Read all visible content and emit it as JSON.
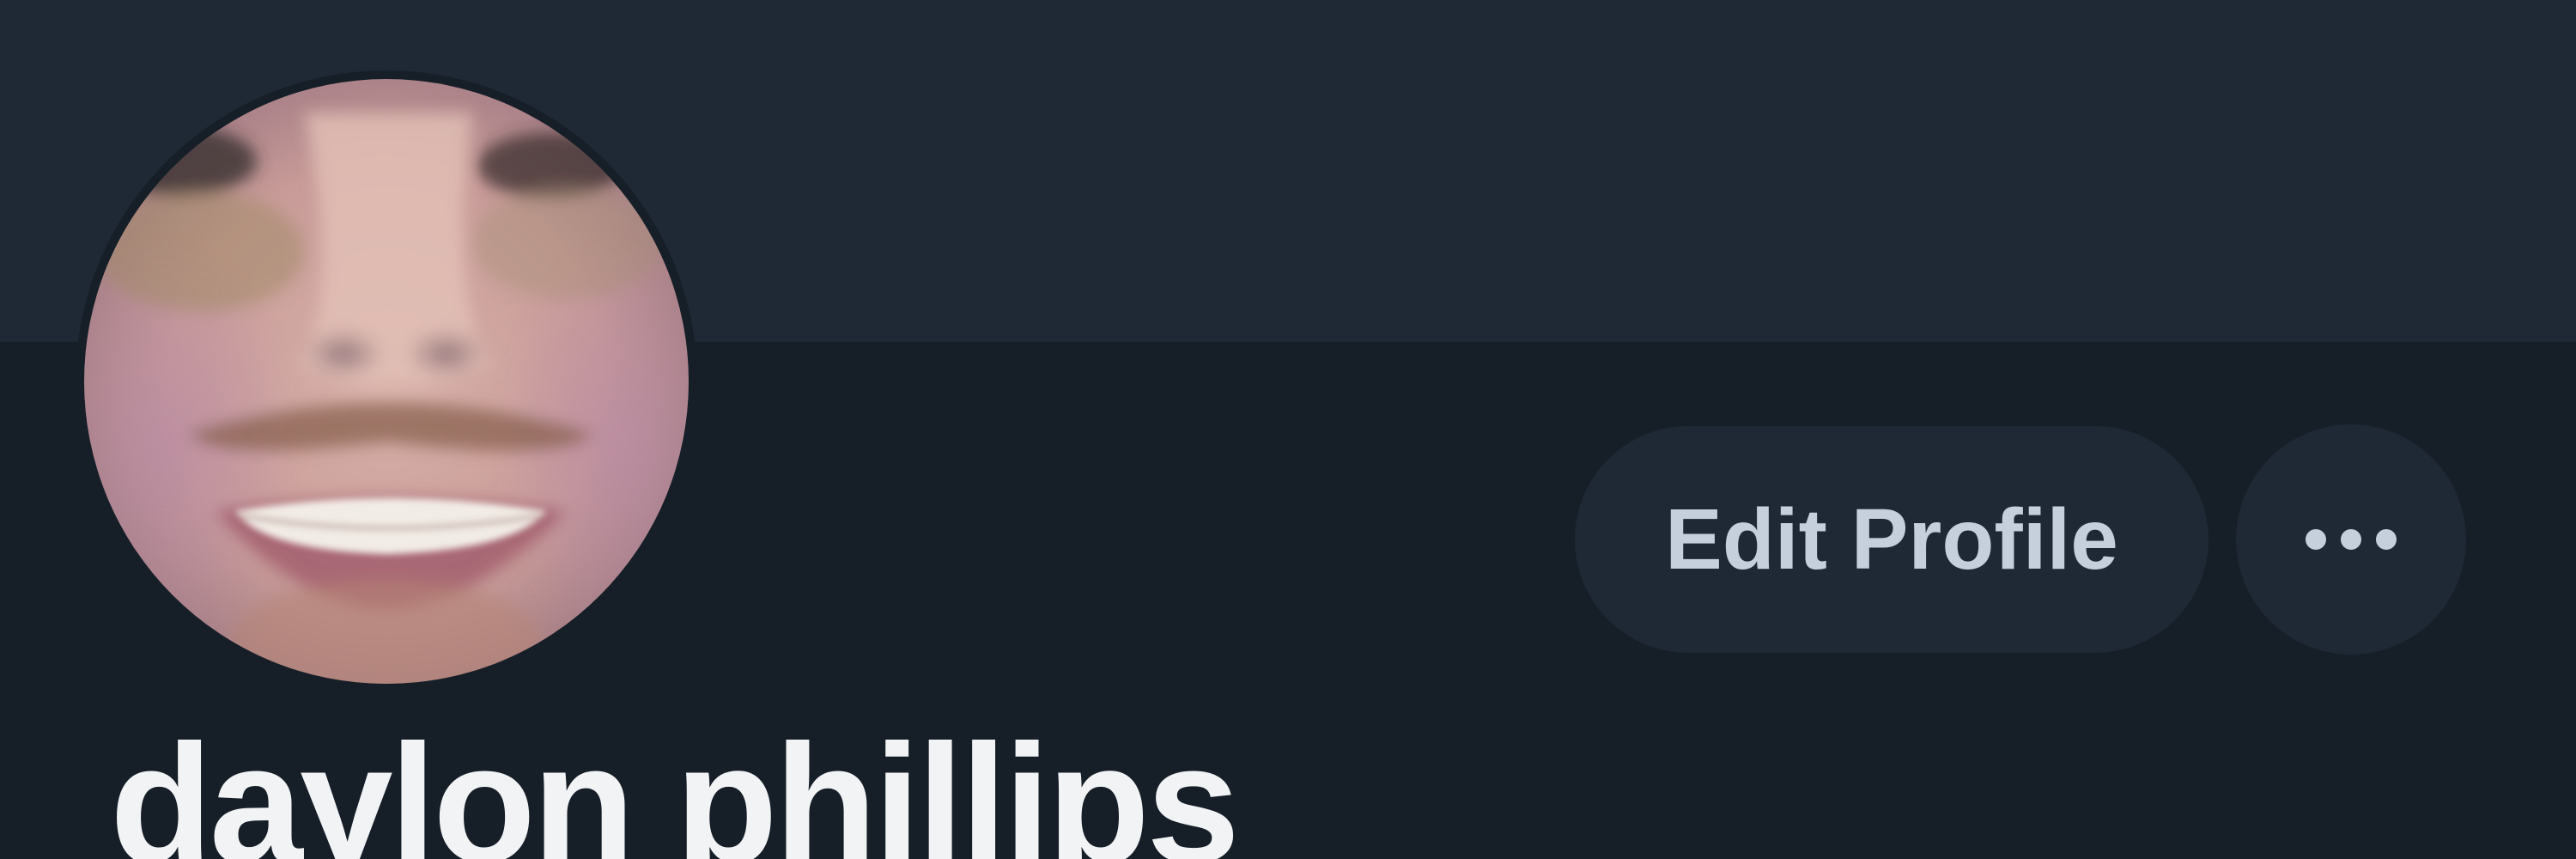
{
  "profile": {
    "display_name": "daylon phillips",
    "avatar_alt": "profile photo"
  },
  "actions": {
    "edit_profile_label": "Edit Profile",
    "more_icon": "ellipsis-horizontal-icon"
  },
  "colors": {
    "page_background": "#161e27",
    "banner_background": "#1e2935",
    "button_background": "#1e2935",
    "button_text": "#c5d0dc",
    "name_text": "#f1f3f5"
  }
}
